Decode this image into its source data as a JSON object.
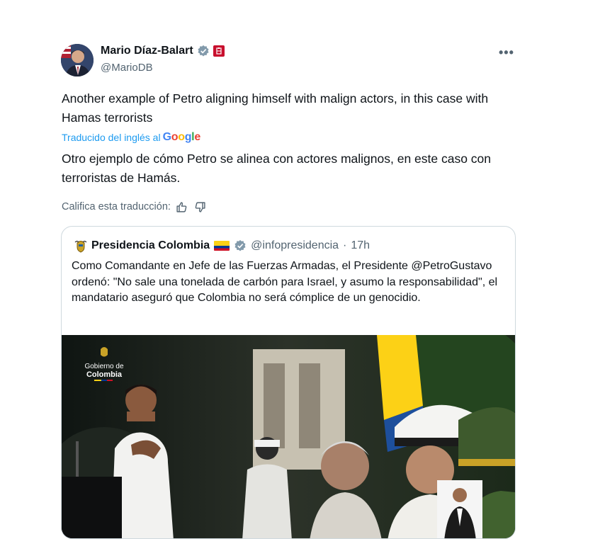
{
  "author": {
    "name": "Mario Díaz-Balart",
    "handle": "@MarioDB",
    "avatar_icon": "person-avatar",
    "verified_color": "#829aab",
    "affiliation_color": "#c8102e"
  },
  "more_label": "•••",
  "tweet": {
    "text": "Another example of Petro aligning himself with malign actors, in this case with Hamas terrorists"
  },
  "translation": {
    "label": "Traducido del inglés al",
    "provider": "Google",
    "text": "Otro ejemplo de cómo Petro se alinea con actores malignos, en este caso con terroristas de Hamás.",
    "rate_label": "Califica esta traducción:",
    "link_color": "#1d9bf0"
  },
  "quote": {
    "name": "Presidencia Colombia",
    "handle": "@infopresidencia",
    "separator": "·",
    "time": "17h",
    "text": "Como Comandante en Jefe de las Fuerzas Armadas, el Presidente @PetroGustavo ordenó: \"No sale una tonelada de carbón para Israel, y asumo la responsabilidad\", el mandatario aseguró que Colombia no será cómplice de un genocidio.",
    "media_watermark_top": "Gobierno de",
    "media_watermark_bottom": "Colombia"
  }
}
